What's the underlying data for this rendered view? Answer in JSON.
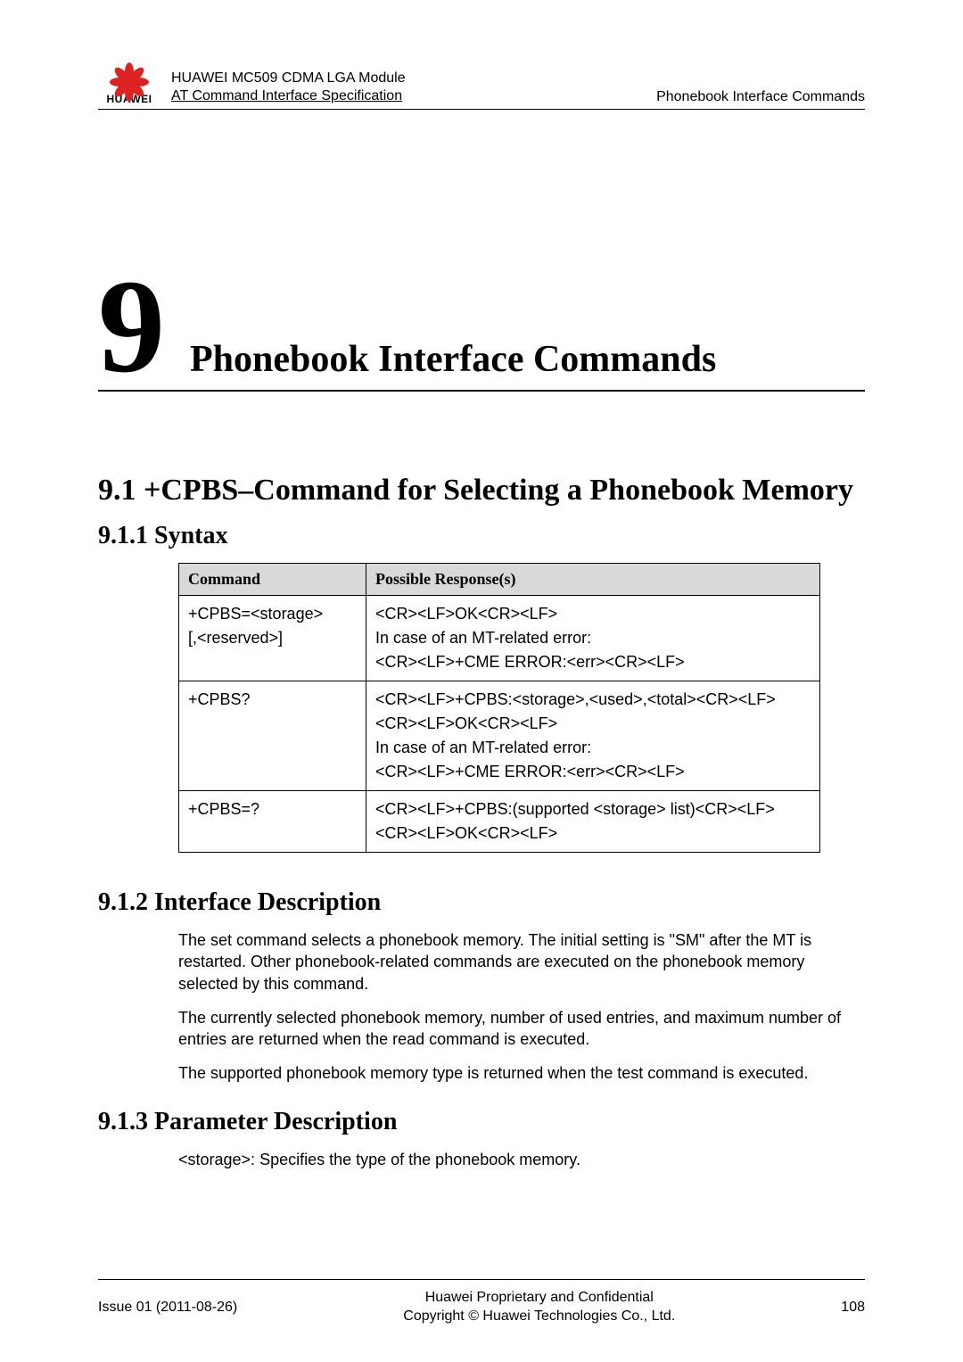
{
  "header": {
    "logo_text": "HUAWEI",
    "line1": "HUAWEI MC509 CDMA LGA Module",
    "line2": "AT Command Interface Specification",
    "right": "Phonebook Interface Commands"
  },
  "chapter": {
    "number": "9",
    "title": "Phonebook Interface Commands"
  },
  "section": {
    "h1": "9.1 +CPBS–Command for Selecting a Phonebook Memory",
    "h2_syntax": "9.1.1 Syntax",
    "h2_interface": "9.1.2 Interface Description",
    "h2_param": "9.1.3 Parameter Description"
  },
  "table": {
    "head_cmd": "Command",
    "head_resp": "Possible Response(s)",
    "rows": [
      {
        "cmd_l1": "+CPBS=<storage>",
        "cmd_l2": "[,<reserved>]",
        "resp_l1": "<CR><LF>OK<CR><LF>",
        "resp_l2": "In case of an MT-related error:",
        "resp_l3": "<CR><LF>+CME ERROR:<err><CR><LF>"
      },
      {
        "cmd_l1": "+CPBS?",
        "resp_l1": "<CR><LF>+CPBS:<storage>,<used>,<total><CR><LF>",
        "resp_l2": "<CR><LF>OK<CR><LF>",
        "resp_l3": "In case of an MT-related error:",
        "resp_l4": "<CR><LF>+CME ERROR:<err><CR><LF>"
      },
      {
        "cmd_l1": "+CPBS=?",
        "resp_l1": "<CR><LF>+CPBS:(supported <storage> list)<CR><LF>",
        "resp_l2": "<CR><LF>OK<CR><LF>"
      }
    ]
  },
  "interface_desc": {
    "p1": "The set command selects a phonebook memory. The initial setting is \"SM\" after the MT is restarted. Other phonebook-related commands are executed on the phonebook memory selected by this command.",
    "p2": "The currently selected phonebook memory, number of used entries, and maximum number of entries are returned when the read command is executed.",
    "p3": "The supported phonebook memory type is returned when the test command is executed."
  },
  "param_desc": {
    "p1": "<storage>: Specifies the type of the phonebook memory."
  },
  "footer": {
    "left": "Issue 01 (2011-08-26)",
    "center_l1": "Huawei Proprietary and Confidential",
    "center_l2": "Copyright © Huawei Technologies Co., Ltd.",
    "right": "108"
  }
}
